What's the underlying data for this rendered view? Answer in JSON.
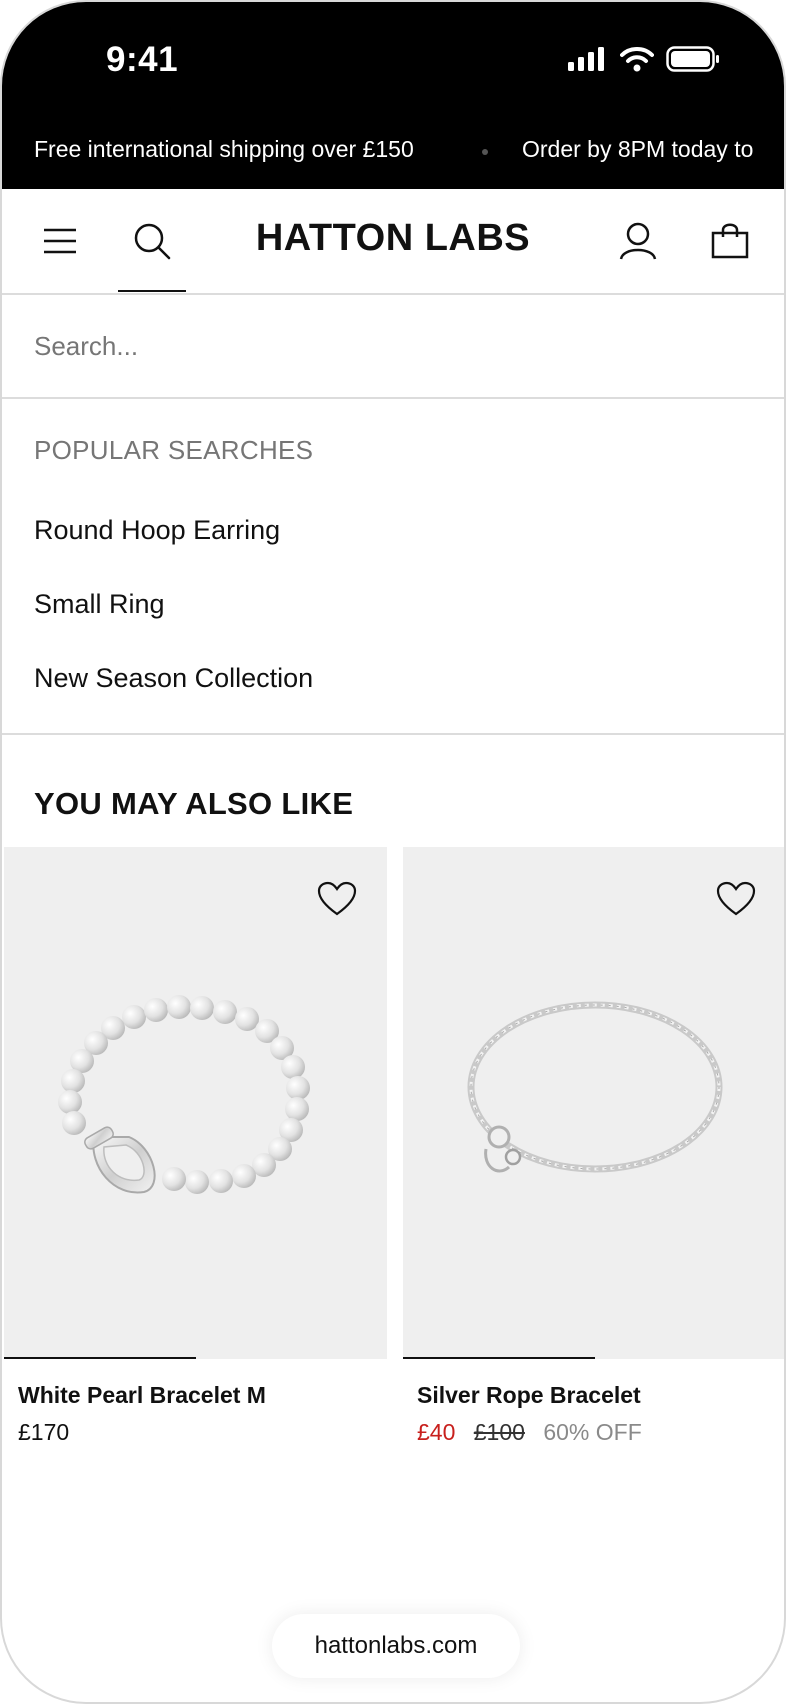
{
  "status_bar": {
    "time": "9:41"
  },
  "promo": {
    "items": [
      "Free international shipping over £150",
      "Order by 8PM today to"
    ]
  },
  "header": {
    "brand": "HATTON LABS",
    "icons": [
      "menu-icon",
      "search-icon",
      "account-icon",
      "bag-icon"
    ]
  },
  "search": {
    "placeholder": "Search...",
    "value": ""
  },
  "popular": {
    "heading": "POPULAR SEARCHES",
    "items": [
      "Round Hoop Earring",
      "Small Ring",
      "New Season Collection"
    ]
  },
  "recommendations": {
    "heading": "YOU MAY ALSO LIKE",
    "products": [
      {
        "name": "White Pearl Bracelet M",
        "price": "£170",
        "gallery_progress": 0.5
      },
      {
        "name": "Silver Rope Bracelet",
        "sale_price": "£40",
        "original_price": "£100",
        "discount": "60% OFF",
        "gallery_progress": 0.5
      }
    ]
  },
  "browser": {
    "url": "hattonlabs.com"
  },
  "colors": {
    "sale": "#c8201d",
    "muted": "#767676",
    "image_bg": "#efefef"
  }
}
